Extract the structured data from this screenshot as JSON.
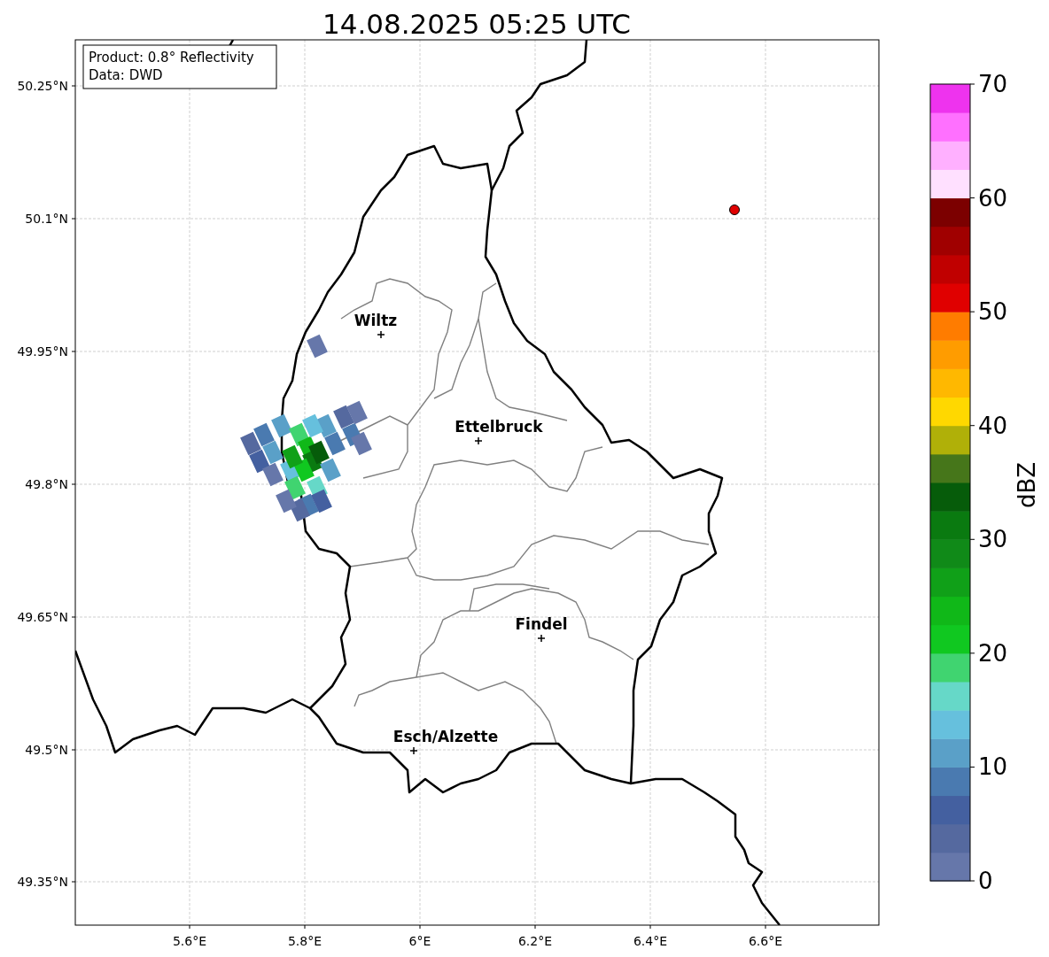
{
  "title": "14.08.2025 05:25 UTC",
  "info_box": {
    "lines": [
      "Product: 0.8° Reflectivity",
      "Data: DWD"
    ]
  },
  "map": {
    "lat_labels": [
      "50.25°N",
      "50.1°N",
      "49.95°N",
      "49.8°N",
      "49.65°N",
      "49.5°N",
      "49.35°N"
    ],
    "lon_labels": [
      "5.6°E",
      "5.8°E",
      "6°E",
      "6.2°E",
      "6.4°E",
      "6.6°E"
    ],
    "cities": [
      {
        "name": "Wiltz"
      },
      {
        "name": "Ettelbruck"
      },
      {
        "name": "Findel"
      },
      {
        "name": "Esch/Alzette"
      }
    ]
  },
  "colorbar": {
    "label": "dBZ",
    "ticks": [
      "70",
      "60",
      "50",
      "40",
      "30",
      "20",
      "10",
      "0"
    ],
    "segments": [
      {
        "color": "#6677aa"
      },
      {
        "color": "#55699f"
      },
      {
        "color": "#4460a0"
      },
      {
        "color": "#4a7ab0"
      },
      {
        "color": "#5aa0c8"
      },
      {
        "color": "#66c0dd"
      },
      {
        "color": "#66d8c8"
      },
      {
        "color": "#40d470"
      },
      {
        "color": "#10c820"
      },
      {
        "color": "#10b818"
      },
      {
        "color": "#10a018"
      },
      {
        "color": "#108a18"
      },
      {
        "color": "#0a7a10"
      },
      {
        "color": "#065c0a"
      },
      {
        "color": "#46761a"
      },
      {
        "color": "#b0b008"
      },
      {
        "color": "#ffd800"
      },
      {
        "color": "#ffb800"
      },
      {
        "color": "#ff9c00"
      },
      {
        "color": "#ff7c00"
      },
      {
        "color": "#e00000"
      },
      {
        "color": "#c00000"
      },
      {
        "color": "#a00000"
      },
      {
        "color": "#7c0000"
      },
      {
        "color": "#ffe0ff"
      },
      {
        "color": "#ffb0ff"
      },
      {
        "color": "#ff70ff"
      },
      {
        "color": "#ee33ee"
      }
    ]
  }
}
